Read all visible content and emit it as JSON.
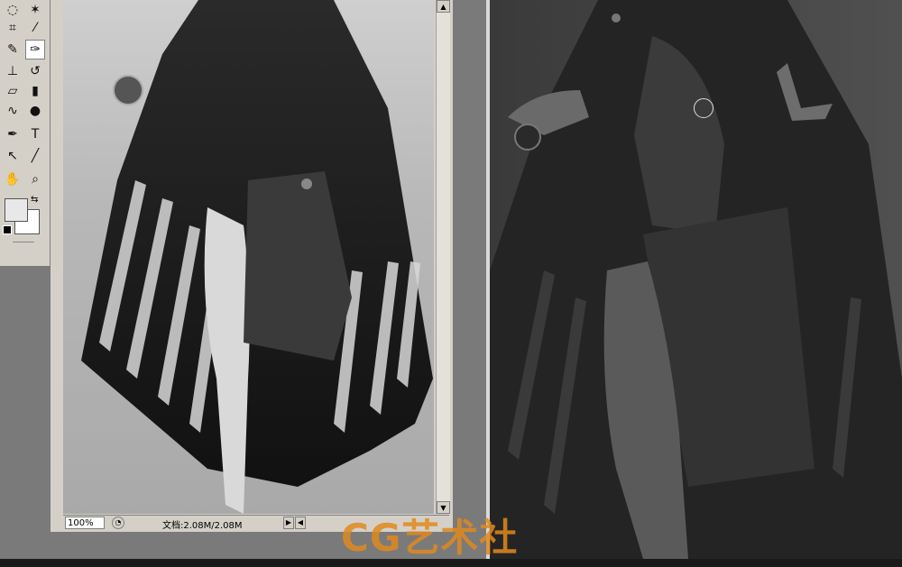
{
  "toolbox": {
    "tools": [
      {
        "name": "lasso-tool",
        "glyph": "◌"
      },
      {
        "name": "magic-wand-tool",
        "glyph": "✶"
      },
      {
        "name": "crop-tool",
        "glyph": "⌗"
      },
      {
        "name": "eyedropper-tool",
        "glyph": "⁄"
      },
      {
        "name": "healing-brush-tool",
        "glyph": "✎"
      },
      {
        "name": "brush-tool",
        "glyph": "✑"
      },
      {
        "name": "clone-stamp-tool",
        "glyph": "⊥"
      },
      {
        "name": "history-brush-tool",
        "glyph": "↺"
      },
      {
        "name": "eraser-tool",
        "glyph": "▱"
      },
      {
        "name": "gradient-tool",
        "glyph": "▮"
      },
      {
        "name": "smudge-tool",
        "glyph": "∿"
      },
      {
        "name": "dodge-tool",
        "glyph": "●"
      },
      {
        "name": "pen-tool",
        "glyph": "✒"
      },
      {
        "name": "type-tool",
        "glyph": "T"
      },
      {
        "name": "path-selection-tool",
        "glyph": "↖"
      },
      {
        "name": "line-tool",
        "glyph": "╱"
      },
      {
        "name": "hand-tool",
        "glyph": "✋"
      },
      {
        "name": "zoom-tool",
        "glyph": "⌕"
      }
    ],
    "swap_glyph": "⇆"
  },
  "document": {
    "zoom": "100%",
    "doc_info": "文档:2.08M/2.08M",
    "scroll_up_glyph": "▲",
    "scroll_down_glyph": "▼",
    "next_glyph": "▶",
    "prev_glyph": "◀",
    "nav_glyph": "◔"
  },
  "watermark": "CG艺术社"
}
